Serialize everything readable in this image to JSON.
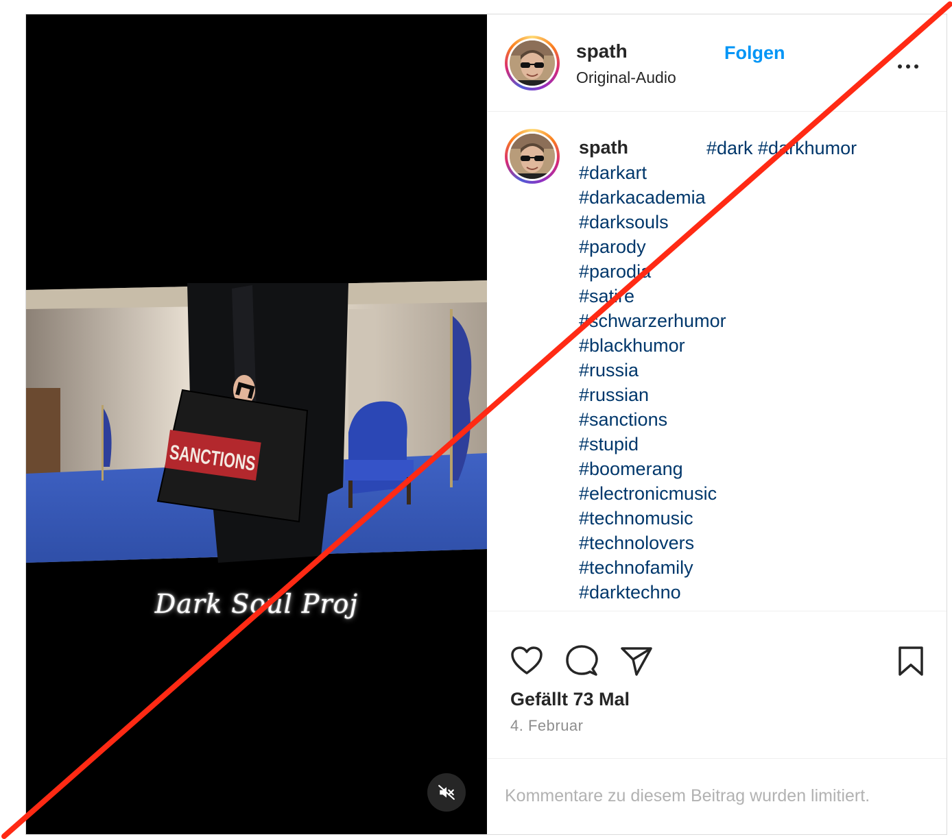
{
  "post": {
    "author": {
      "username": "spath",
      "audio_label": "Original-Audio",
      "follow_label": "Folgen"
    },
    "media": {
      "briefcase_label": "SANCTIONS",
      "overlay_text": "Dark Soul Proj"
    },
    "caption": {
      "username": "spath",
      "inline_tags": "#dark #darkhumor",
      "hashtags": [
        "#darkart",
        "#darkacademia",
        "#darksouls",
        "#parody",
        "#parodia",
        "#satire",
        "#schwarzerhumor",
        "#blackhumor",
        "#russia",
        "#russian",
        "#sanctions",
        "#stupid",
        "#boomerang",
        "#electronicmusic",
        "#technomusic",
        "#technolovers",
        "#technofamily",
        "#darktechno"
      ]
    },
    "likes_label": "Gefällt 73 Mal",
    "date_label": "4. Februar",
    "comments_limited_label": "Kommentare zu diesem Beitrag wurden limitiert."
  },
  "icons": {
    "like": "heart-icon",
    "comment": "comment-icon",
    "share": "paper-plane-icon",
    "save": "bookmark-icon",
    "more": "more-dots-icon",
    "mute": "speaker-muted-icon"
  },
  "colors": {
    "accent": "#0095f6",
    "hashtag": "#00376b",
    "cross_out": "#ff2a14",
    "muted_text": "#8e8e8e"
  }
}
